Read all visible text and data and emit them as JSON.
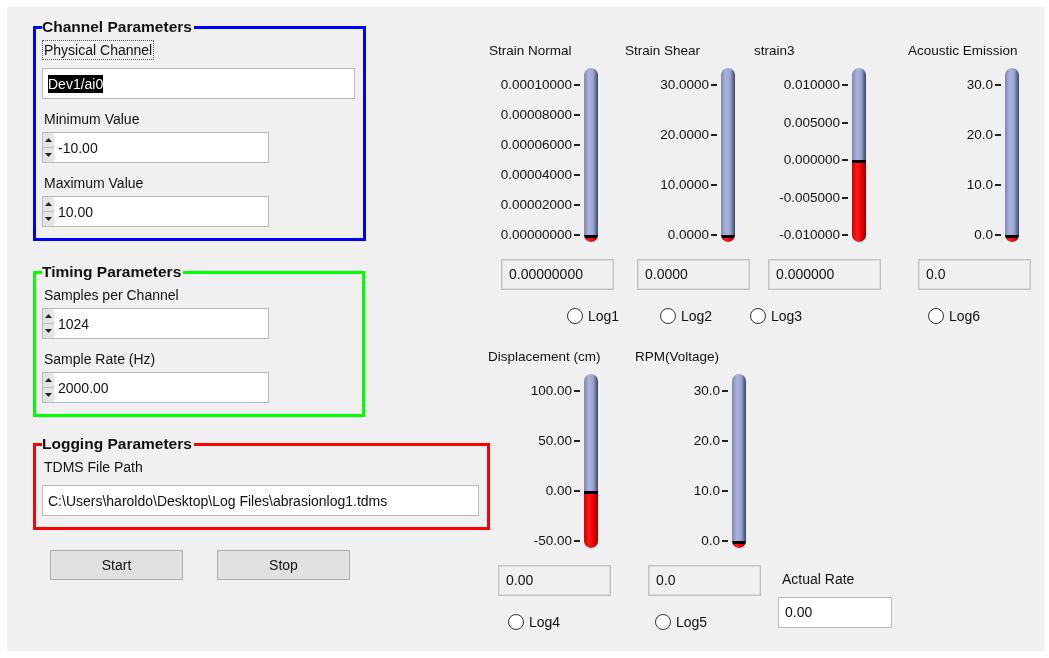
{
  "groups": [
    {
      "title": "Channel Parameters",
      "color": "#0000ff",
      "fields": [
        {
          "kind": "text",
          "label": "Physical Channel",
          "focused": true,
          "value": "Dev1/ai0",
          "highlighted": true
        },
        {
          "kind": "spin",
          "label": "Minimum Value",
          "focused": false,
          "value": "-10.00",
          "highlighted": false
        },
        {
          "kind": "spin",
          "label": "Maximum Value",
          "focused": false,
          "value": "10.00",
          "highlighted": false
        }
      ]
    },
    {
      "title": "Timing Parameters",
      "color": "#00ff00",
      "fields": [
        {
          "kind": "spin",
          "label": "Samples per Channel",
          "focused": false,
          "value": "1024",
          "highlighted": false
        },
        {
          "kind": "spin",
          "label": "Sample Rate (Hz)",
          "focused": false,
          "value": "2000.00",
          "highlighted": false
        }
      ]
    },
    {
      "title": "Logging Parameters",
      "color": "#ff0000",
      "fields": [
        {
          "kind": "text",
          "label": "TDMS File Path",
          "focused": false,
          "value": "C:\\Users\\haroldo\\Desktop\\Log Files\\abrasionlog1.tdms",
          "highlighted": false
        }
      ]
    }
  ],
  "buttons": [
    {
      "label": "Start"
    },
    {
      "label": "Stop"
    }
  ],
  "gauges": [
    {
      "title": "Strain Normal",
      "ticks": [
        "0.00010000",
        "0.00008000",
        "0.00006000",
        "0.00004000",
        "0.00002000",
        "0.00000000"
      ],
      "level": 0,
      "reading": "0.00000000",
      "log": {
        "label": "Log1",
        "selected": false
      }
    },
    {
      "title": "Strain Shear",
      "ticks": [
        "30.0000",
        "20.0000",
        "10.0000",
        "0.0000"
      ],
      "level": 0,
      "reading": "0.0000",
      "log": {
        "label": "Log2",
        "selected": false
      }
    },
    {
      "title": "strain3",
      "ticks": [
        "0.010000",
        "0.005000",
        "0.000000",
        "-0.005000",
        "-0.010000"
      ],
      "level": 0.5,
      "reading": "0.000000",
      "log": {
        "label": "Log3",
        "selected": false
      }
    },
    {
      "title": "Acoustic Emission",
      "ticks": [
        "30.0",
        "20.0",
        "10.0",
        "0.0"
      ],
      "level": 0,
      "reading": "0.0",
      "log": {
        "label": "Log6",
        "selected": false
      }
    },
    {
      "title": "Displacement (cm)",
      "ticks": [
        "100.00",
        "50.00",
        "0.00",
        "-50.00"
      ],
      "level": 0.3333,
      "reading": "0.00",
      "log": {
        "label": "Log4",
        "selected": false
      }
    },
    {
      "title": "RPM(Voltage)",
      "ticks": [
        "30.0",
        "20.0",
        "10.0",
        "0.0"
      ],
      "level": 0,
      "reading": "0.0",
      "log": {
        "label": "Log5",
        "selected": false
      }
    }
  ],
  "actual_rate": {
    "label": "Actual Rate",
    "value": "0.00"
  }
}
